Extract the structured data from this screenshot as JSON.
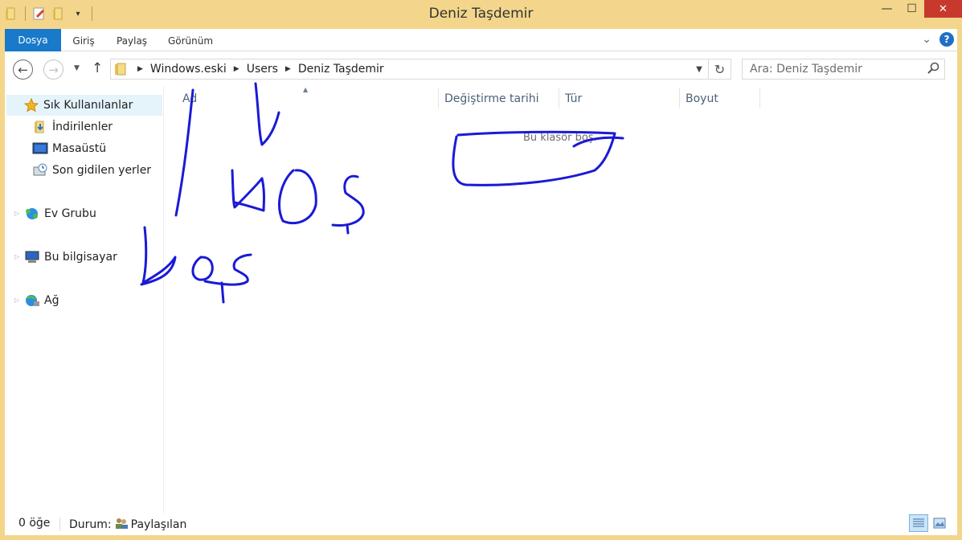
{
  "window": {
    "title": "Deniz Taşdemir",
    "controls": {
      "minimize": "—",
      "maximize": "☐",
      "close": "✕"
    }
  },
  "ribbon": {
    "tabs": [
      "Dosya",
      "Giriş",
      "Paylaş",
      "Görünüm"
    ],
    "expand_icon": "chevron-down-icon",
    "help_label": "?"
  },
  "address_bar": {
    "breadcrumbs": [
      "Windows.eski",
      "Users",
      "Deniz Taşdemir"
    ],
    "back_label": "←",
    "forward_label": "→",
    "up_label": "↑",
    "refresh_label": "↻"
  },
  "search": {
    "placeholder": "Ara: Deniz Taşdemir"
  },
  "nav_pane": {
    "items": [
      {
        "label": "Sık Kullanılanlar",
        "icon": "star-icon"
      },
      {
        "label": "İndirilenler",
        "icon": "downloads-folder-icon"
      },
      {
        "label": "Masaüstü",
        "icon": "desktop-icon"
      },
      {
        "label": "Son gidilen yerler",
        "icon": "recent-places-icon"
      },
      {
        "label": "Ev Grubu",
        "icon": "homegroup-icon"
      },
      {
        "label": "Bu bilgisayar",
        "icon": "computer-icon"
      },
      {
        "label": "Ağ",
        "icon": "network-icon"
      }
    ]
  },
  "columns": [
    "Ad",
    "Değiştirme tarihi",
    "Tür",
    "Boyut"
  ],
  "empty_message": "Bu klasör boş.",
  "status_bar": {
    "item_count": "0 öğe",
    "state_label": "Durum:",
    "state_value": "Paylaşılan"
  },
  "annotations": {
    "handwritten_text": [
      "boş",
      "boş"
    ],
    "color": "#1a1ad6"
  },
  "colors": {
    "frame": "#f3d68b",
    "file_tab": "#1979ca",
    "close_button": "#c7392d",
    "column_header_text": "#4c607a"
  }
}
